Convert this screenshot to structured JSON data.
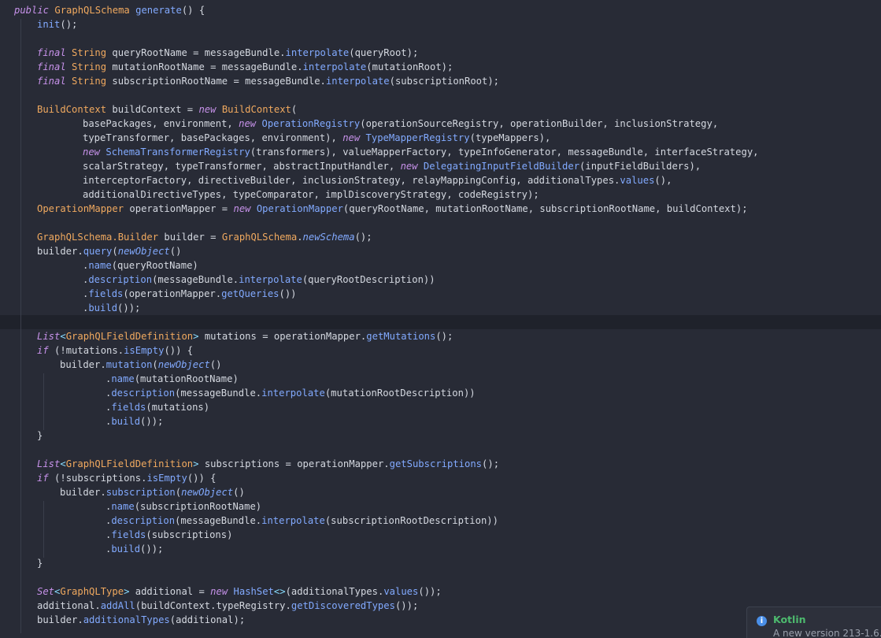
{
  "editor": {
    "language": "Java",
    "lines": [
      {
        "indent": 0,
        "tokens": [
          [
            "kw",
            "public"
          ],
          [
            "nm",
            " "
          ],
          [
            "type",
            "GraphQLSchema"
          ],
          [
            "nm",
            " "
          ],
          [
            "fn",
            "generate"
          ],
          [
            "nm",
            "() {"
          ]
        ]
      },
      {
        "indent": 1,
        "tokens": [
          [
            "fn",
            "init"
          ],
          [
            "nm",
            "();"
          ]
        ]
      },
      {
        "indent": 0,
        "tokens": []
      },
      {
        "indent": 1,
        "tokens": [
          [
            "kw",
            "final"
          ],
          [
            "nm",
            " "
          ],
          [
            "type",
            "String"
          ],
          [
            "nm",
            " queryRootName = messageBundle."
          ],
          [
            "fn",
            "interpolate"
          ],
          [
            "nm",
            "(queryRoot);"
          ]
        ]
      },
      {
        "indent": 1,
        "tokens": [
          [
            "kw",
            "final"
          ],
          [
            "nm",
            " "
          ],
          [
            "type",
            "String"
          ],
          [
            "nm",
            " mutationRootName = messageBundle."
          ],
          [
            "fn",
            "interpolate"
          ],
          [
            "nm",
            "(mutationRoot);"
          ]
        ]
      },
      {
        "indent": 1,
        "tokens": [
          [
            "kw",
            "final"
          ],
          [
            "nm",
            " "
          ],
          [
            "type",
            "String"
          ],
          [
            "nm",
            " subscriptionRootName = messageBundle."
          ],
          [
            "fn",
            "interpolate"
          ],
          [
            "nm",
            "(subscriptionRoot);"
          ]
        ]
      },
      {
        "indent": 0,
        "tokens": []
      },
      {
        "indent": 1,
        "tokens": [
          [
            "type",
            "BuildContext"
          ],
          [
            "nm",
            " buildContext = "
          ],
          [
            "kw",
            "new"
          ],
          [
            "nm",
            " "
          ],
          [
            "type",
            "BuildContext"
          ],
          [
            "nm",
            "("
          ]
        ]
      },
      {
        "indent": 3,
        "tokens": [
          [
            "nm",
            "basePackages, environment, "
          ],
          [
            "kw",
            "new"
          ],
          [
            "nm",
            " "
          ],
          [
            "fn",
            "OperationRegistry"
          ],
          [
            "nm",
            "(operationSourceRegistry, operationBuilder, inclusionStrategy,"
          ]
        ]
      },
      {
        "indent": 3,
        "tokens": [
          [
            "nm",
            "typeTransformer, basePackages, environment), "
          ],
          [
            "kw",
            "new"
          ],
          [
            "nm",
            " "
          ],
          [
            "fn",
            "TypeMapperRegistry"
          ],
          [
            "nm",
            "(typeMappers),"
          ]
        ]
      },
      {
        "indent": 3,
        "tokens": [
          [
            "kw",
            "new"
          ],
          [
            "nm",
            " "
          ],
          [
            "fn",
            "SchemaTransformerRegistry"
          ],
          [
            "nm",
            "(transformers), valueMapperFactory, typeInfoGenerator, messageBundle, interfaceStrategy,"
          ]
        ]
      },
      {
        "indent": 3,
        "tokens": [
          [
            "nm",
            "scalarStrategy, typeTransformer, abstractInputHandler, "
          ],
          [
            "kw",
            "new"
          ],
          [
            "nm",
            " "
          ],
          [
            "fn",
            "DelegatingInputFieldBuilder"
          ],
          [
            "nm",
            "(inputFieldBuilders),"
          ]
        ]
      },
      {
        "indent": 3,
        "tokens": [
          [
            "nm",
            "interceptorFactory, directiveBuilder, inclusionStrategy, relayMappingConfig, additionalTypes."
          ],
          [
            "fn",
            "values"
          ],
          [
            "nm",
            "(),"
          ]
        ]
      },
      {
        "indent": 3,
        "tokens": [
          [
            "nm",
            "additionalDirectiveTypes, typeComparator, implDiscoveryStrategy, codeRegistry);"
          ]
        ]
      },
      {
        "indent": 1,
        "tokens": [
          [
            "type",
            "OperationMapper"
          ],
          [
            "nm",
            " operationMapper = "
          ],
          [
            "kw",
            "new"
          ],
          [
            "nm",
            " "
          ],
          [
            "fn",
            "OperationMapper"
          ],
          [
            "nm",
            "(queryRootName, mutationRootName, subscriptionRootName, buildContext);"
          ]
        ]
      },
      {
        "indent": 0,
        "tokens": []
      },
      {
        "indent": 1,
        "tokens": [
          [
            "type",
            "GraphQLSchema.Builder"
          ],
          [
            "nm",
            " builder = "
          ],
          [
            "type",
            "GraphQLSchema"
          ],
          [
            "nm",
            "."
          ],
          [
            "sfn",
            "newSchema"
          ],
          [
            "nm",
            "();"
          ]
        ]
      },
      {
        "indent": 1,
        "tokens": [
          [
            "nm",
            "builder."
          ],
          [
            "fn",
            "query"
          ],
          [
            "nm",
            "("
          ],
          [
            "sfn",
            "newObject"
          ],
          [
            "nm",
            "()"
          ]
        ]
      },
      {
        "indent": 3,
        "tokens": [
          [
            "nm",
            "."
          ],
          [
            "fn",
            "name"
          ],
          [
            "nm",
            "(queryRootName)"
          ]
        ]
      },
      {
        "indent": 3,
        "tokens": [
          [
            "nm",
            "."
          ],
          [
            "fn",
            "description"
          ],
          [
            "nm",
            "(messageBundle."
          ],
          [
            "fn",
            "interpolate"
          ],
          [
            "nm",
            "(queryRootDescription))"
          ]
        ]
      },
      {
        "indent": 3,
        "tokens": [
          [
            "nm",
            "."
          ],
          [
            "fn",
            "fields"
          ],
          [
            "nm",
            "(operationMapper."
          ],
          [
            "fn",
            "getQueries"
          ],
          [
            "nm",
            "())"
          ]
        ]
      },
      {
        "indent": 3,
        "tokens": [
          [
            "nm",
            "."
          ],
          [
            "fn",
            "build"
          ],
          [
            "nm",
            "());"
          ]
        ]
      },
      {
        "indent": 0,
        "tokens": [],
        "current": true
      },
      {
        "indent": 1,
        "tokens": [
          [
            "kw",
            "List"
          ],
          [
            "op",
            "<"
          ],
          [
            "type",
            "GraphQLFieldDefinition"
          ],
          [
            "op",
            ">"
          ],
          [
            "nm",
            " mutations = operationMapper."
          ],
          [
            "fn",
            "getMutations"
          ],
          [
            "nm",
            "();"
          ]
        ]
      },
      {
        "indent": 1,
        "tokens": [
          [
            "kw",
            "if"
          ],
          [
            "nm",
            " (!mutations."
          ],
          [
            "fn",
            "isEmpty"
          ],
          [
            "nm",
            "()) {"
          ]
        ]
      },
      {
        "indent": 2,
        "tokens": [
          [
            "nm",
            "builder."
          ],
          [
            "fn",
            "mutation"
          ],
          [
            "nm",
            "("
          ],
          [
            "sfn",
            "newObject"
          ],
          [
            "nm",
            "()"
          ]
        ]
      },
      {
        "indent": 4,
        "tokens": [
          [
            "nm",
            "."
          ],
          [
            "fn",
            "name"
          ],
          [
            "nm",
            "(mutationRootName)"
          ]
        ]
      },
      {
        "indent": 4,
        "tokens": [
          [
            "nm",
            "."
          ],
          [
            "fn",
            "description"
          ],
          [
            "nm",
            "(messageBundle."
          ],
          [
            "fn",
            "interpolate"
          ],
          [
            "nm",
            "(mutationRootDescription))"
          ]
        ]
      },
      {
        "indent": 4,
        "tokens": [
          [
            "nm",
            "."
          ],
          [
            "fn",
            "fields"
          ],
          [
            "nm",
            "(mutations)"
          ]
        ]
      },
      {
        "indent": 4,
        "tokens": [
          [
            "nm",
            "."
          ],
          [
            "fn",
            "build"
          ],
          [
            "nm",
            "());"
          ]
        ]
      },
      {
        "indent": 1,
        "tokens": [
          [
            "nm",
            "}"
          ]
        ]
      },
      {
        "indent": 0,
        "tokens": []
      },
      {
        "indent": 1,
        "tokens": [
          [
            "kw",
            "List"
          ],
          [
            "op",
            "<"
          ],
          [
            "type",
            "GraphQLFieldDefinition"
          ],
          [
            "op",
            ">"
          ],
          [
            "nm",
            " subscriptions = operationMapper."
          ],
          [
            "fn",
            "getSubscriptions"
          ],
          [
            "nm",
            "();"
          ]
        ]
      },
      {
        "indent": 1,
        "tokens": [
          [
            "kw",
            "if"
          ],
          [
            "nm",
            " (!subscriptions."
          ],
          [
            "fn",
            "isEmpty"
          ],
          [
            "nm",
            "()) {"
          ]
        ]
      },
      {
        "indent": 2,
        "tokens": [
          [
            "nm",
            "builder."
          ],
          [
            "fn",
            "subscription"
          ],
          [
            "nm",
            "("
          ],
          [
            "sfn",
            "newObject"
          ],
          [
            "nm",
            "()"
          ]
        ]
      },
      {
        "indent": 4,
        "tokens": [
          [
            "nm",
            "."
          ],
          [
            "fn",
            "name"
          ],
          [
            "nm",
            "(subscriptionRootName)"
          ]
        ]
      },
      {
        "indent": 4,
        "tokens": [
          [
            "nm",
            "."
          ],
          [
            "fn",
            "description"
          ],
          [
            "nm",
            "(messageBundle."
          ],
          [
            "fn",
            "interpolate"
          ],
          [
            "nm",
            "(subscriptionRootDescription))"
          ]
        ]
      },
      {
        "indent": 4,
        "tokens": [
          [
            "nm",
            "."
          ],
          [
            "fn",
            "fields"
          ],
          [
            "nm",
            "(subscriptions)"
          ]
        ]
      },
      {
        "indent": 4,
        "tokens": [
          [
            "nm",
            "."
          ],
          [
            "fn",
            "build"
          ],
          [
            "nm",
            "());"
          ]
        ]
      },
      {
        "indent": 1,
        "tokens": [
          [
            "nm",
            "}"
          ]
        ]
      },
      {
        "indent": 0,
        "tokens": []
      },
      {
        "indent": 1,
        "tokens": [
          [
            "kw",
            "Set"
          ],
          [
            "op",
            "<"
          ],
          [
            "type",
            "GraphQLType"
          ],
          [
            "op",
            ">"
          ],
          [
            "nm",
            " additional = "
          ],
          [
            "kw",
            "new"
          ],
          [
            "nm",
            " "
          ],
          [
            "fn",
            "HashSet"
          ],
          [
            "op",
            "<>"
          ],
          [
            "nm",
            "(additionalTypes."
          ],
          [
            "fn",
            "values"
          ],
          [
            "nm",
            "());"
          ]
        ]
      },
      {
        "indent": 1,
        "tokens": [
          [
            "nm",
            "additional."
          ],
          [
            "fn",
            "addAll"
          ],
          [
            "nm",
            "(buildContext.typeRegistry."
          ],
          [
            "fn",
            "getDiscoveredTypes"
          ],
          [
            "nm",
            "());"
          ]
        ]
      },
      {
        "indent": 1,
        "tokens": [
          [
            "nm",
            "builder."
          ],
          [
            "fn",
            "additionalTypes"
          ],
          [
            "nm",
            "(additional);"
          ]
        ]
      }
    ]
  },
  "notification": {
    "icon": "info-icon",
    "title": "Kotlin",
    "body": "A new version 213-1.6."
  }
}
